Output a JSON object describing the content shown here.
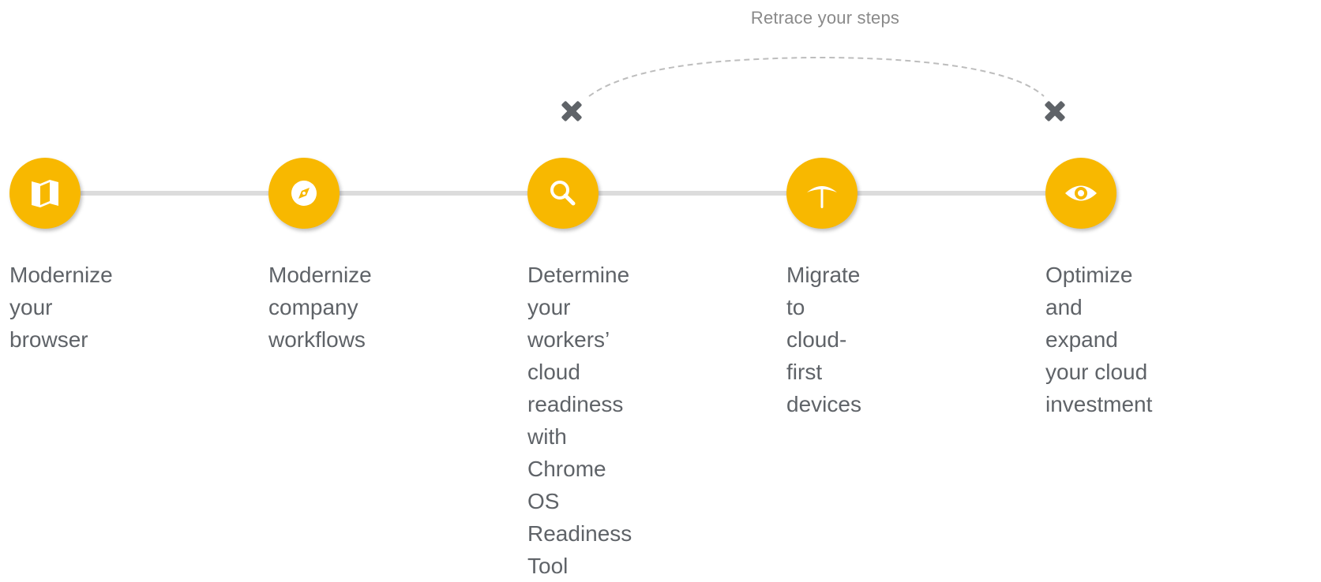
{
  "retrace_label": "Retrace your steps",
  "colors": {
    "step_fill": "#f8b800",
    "connector": "#dcdcdc",
    "text": "#5f6368",
    "dashed_loop": "#bdbdbd",
    "marker": "#5f6368"
  },
  "steps": [
    {
      "icon": "map-icon",
      "label": "Modernize your\nbrowser"
    },
    {
      "icon": "compass-icon",
      "label": "Modernize\ncompany\nworkflows"
    },
    {
      "icon": "search-icon",
      "label": "Determine your\nworkers’ cloud\nreadiness with\nChrome OS\nReadiness Tool"
    },
    {
      "icon": "pickaxe-icon",
      "label": "Migrate to\ncloud-first\ndevices"
    },
    {
      "icon": "eye-icon",
      "label": "Optimize and\nexpand your cloud\ninvestment"
    }
  ]
}
